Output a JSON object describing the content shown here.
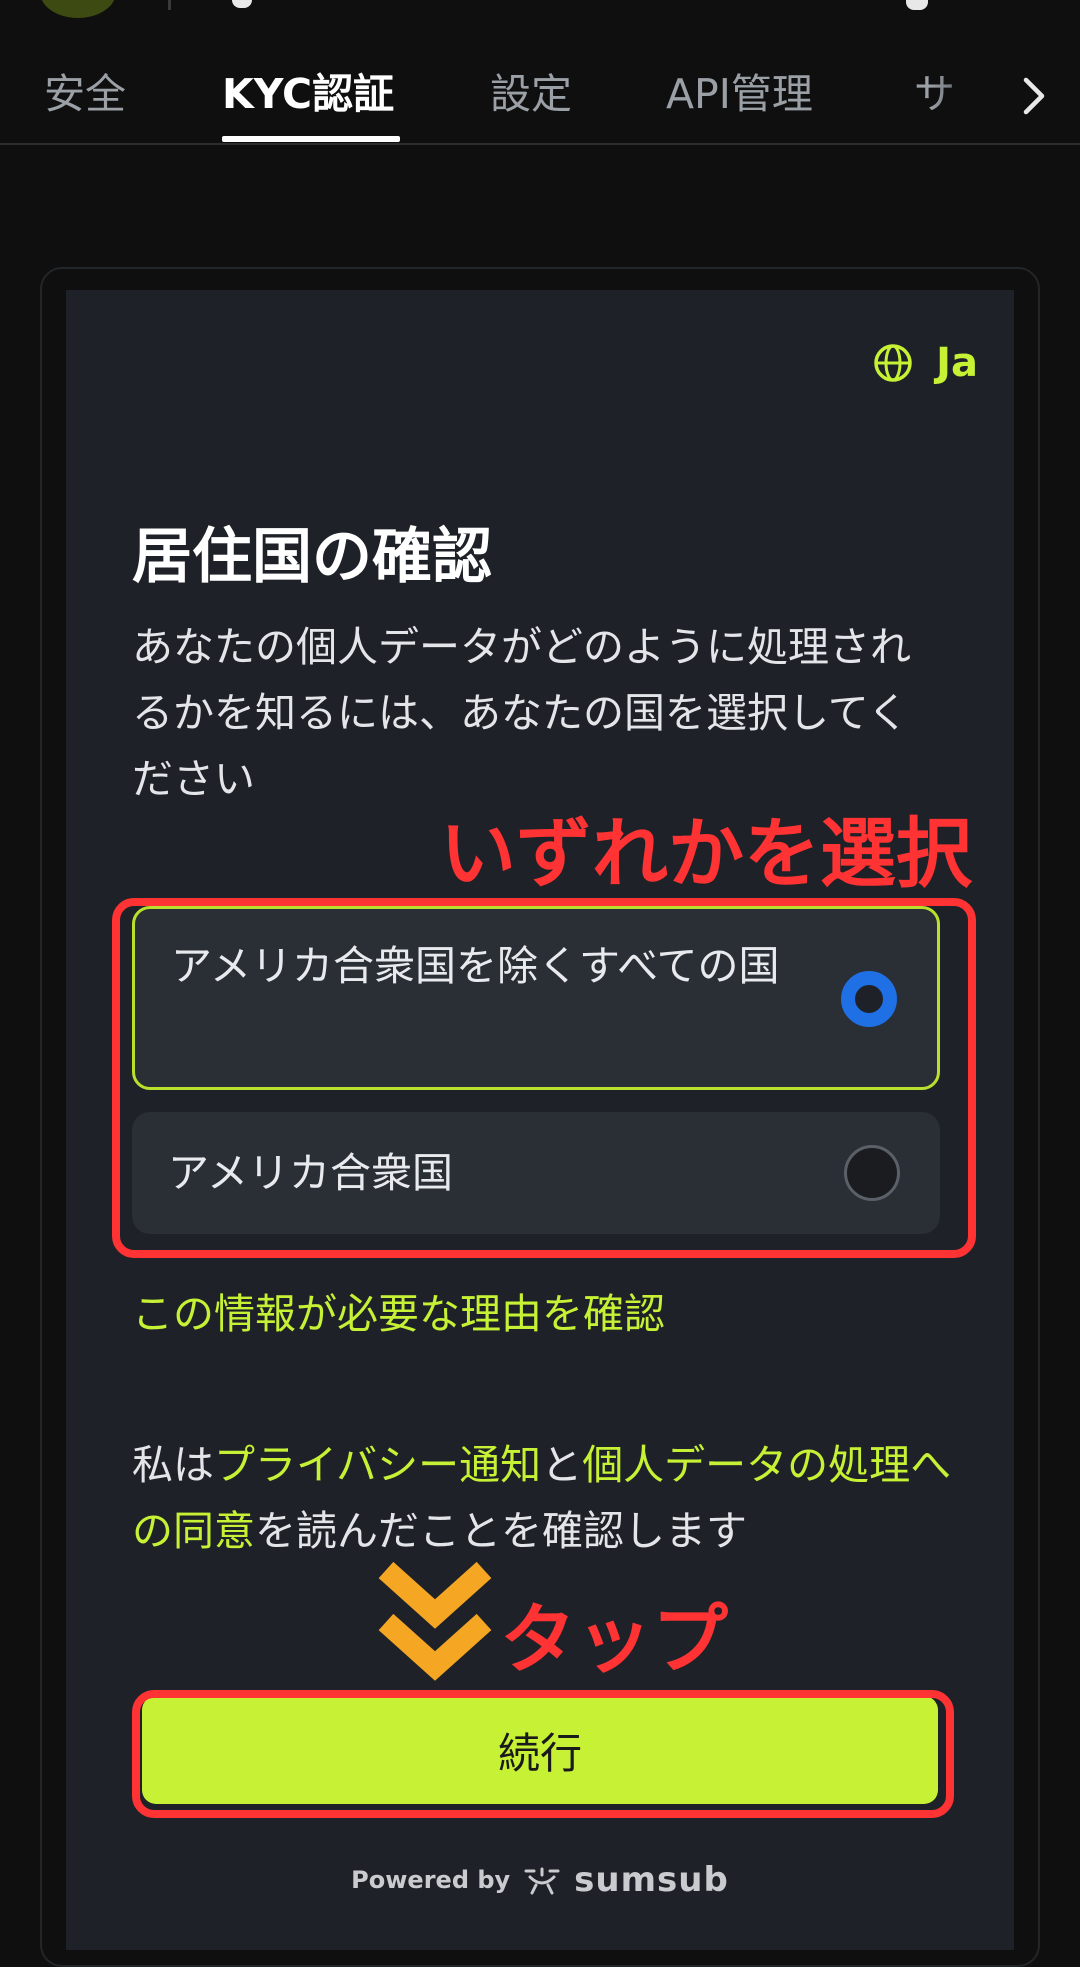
{
  "tabs": [
    {
      "label": "安全",
      "active": false
    },
    {
      "label": "KYC認証",
      "active": true
    },
    {
      "label": "設定",
      "active": false
    },
    {
      "label": "API管理",
      "active": false
    },
    {
      "label": "サ",
      "active": false
    }
  ],
  "colors": {
    "accent": "#c6f135",
    "annotation": "#ff3333",
    "radio_selected": "#1f6fe5",
    "arrow": "#f5a623"
  },
  "lang": {
    "label": "Ja",
    "icon": "globe-icon"
  },
  "heading": "居住国の確認",
  "description": "あなたの個人データがどのように処理されるかを知るには、あなたの国を選択してください",
  "options": [
    {
      "label": "アメリカ合衆国を除くすべての国",
      "selected": true
    },
    {
      "label": "アメリカ合衆国",
      "selected": false
    }
  ],
  "why_link": "この情報が必要な理由を確認",
  "consent": {
    "prefix": "私は",
    "privacy_link": "プライバシー通知",
    "and": "と",
    "data_link": "個人データの処理への同意",
    "suffix": "を読んだことを確認します"
  },
  "continue_label": "続行",
  "powered": {
    "prefix": "Powered by",
    "brand": "sumsub"
  },
  "annotations": {
    "select": "いずれかを選択",
    "tap": "タップ"
  }
}
